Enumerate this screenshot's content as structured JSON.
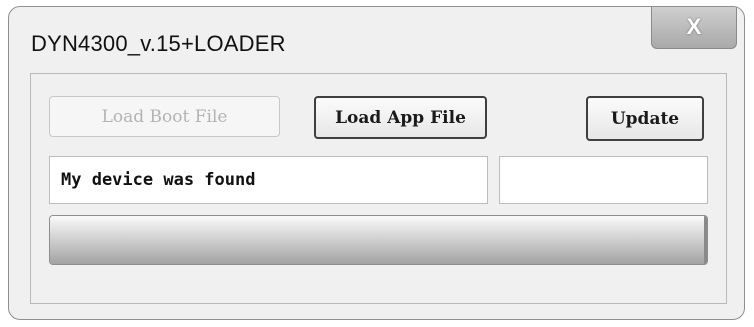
{
  "window": {
    "title": "DYN4300_v.15+LOADER",
    "close_label": "X"
  },
  "toolbar": {
    "load_boot_label": "Load Boot File",
    "load_app_label": "Load App File",
    "update_label": "Update"
  },
  "status": {
    "message": "My device was found",
    "side_value": ""
  },
  "progress": {
    "value_fraction": 1.0
  },
  "colors": {
    "window_bg": "#f0f0f0",
    "disabled_text": "#b3b3b3",
    "close_button": "#a9a9a9"
  }
}
